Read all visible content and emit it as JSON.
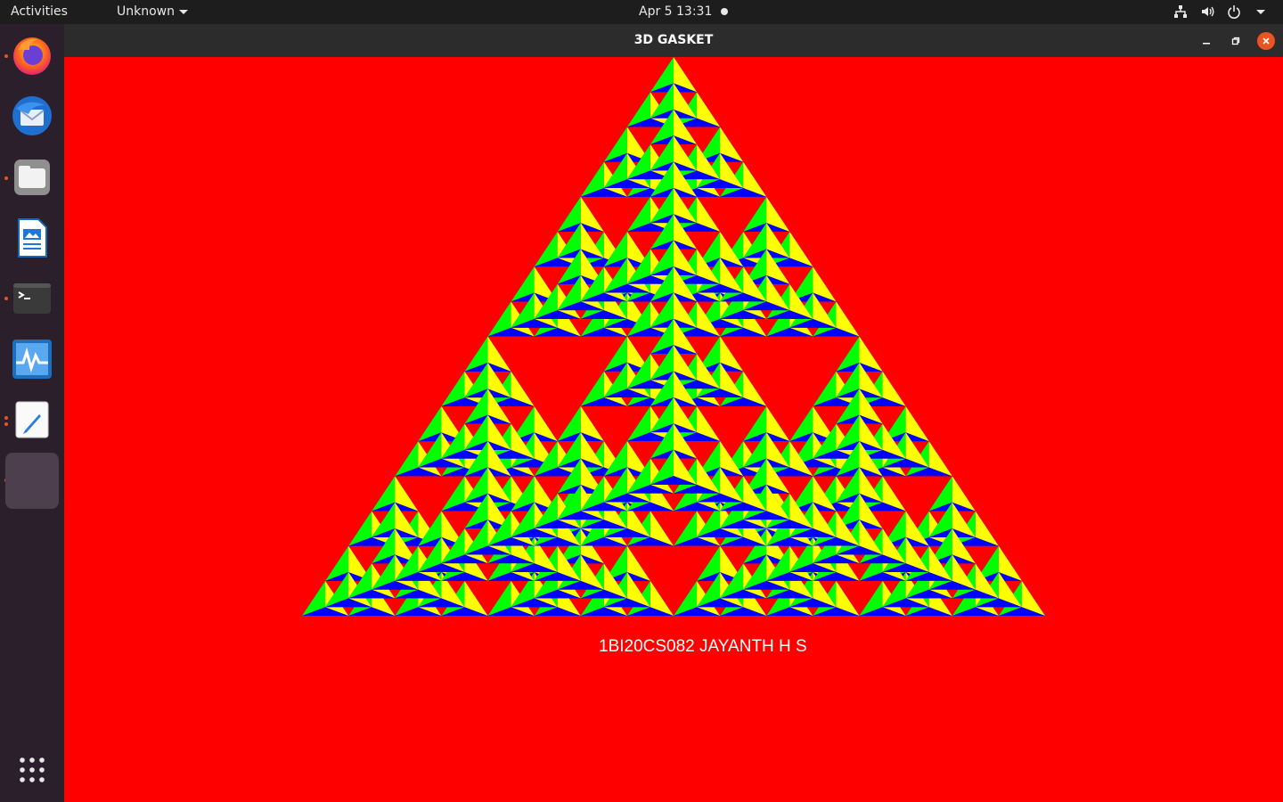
{
  "topbar": {
    "activities": "Activities",
    "app_menu": "Unknown",
    "clock": "Apr 5  13:31",
    "tray_icons": [
      "network-icon",
      "volume-icon",
      "power-icon"
    ]
  },
  "dock": {
    "items": [
      {
        "name": "firefox",
        "running": true
      },
      {
        "name": "thunderbird",
        "running": false
      },
      {
        "name": "files",
        "running": true
      },
      {
        "name": "libreoffice-writer",
        "running": false
      },
      {
        "name": "terminal",
        "running": true
      },
      {
        "name": "system-monitor",
        "running": false
      },
      {
        "name": "text-editor",
        "running": true
      },
      {
        "name": "gasket-app",
        "running": true,
        "active": true
      }
    ],
    "show_apps_icon": "grid-icon"
  },
  "window": {
    "title": "3D GASKET",
    "caption": "1BI20CS082 JAYANTH H S",
    "colors": {
      "background": "#ff0000",
      "face_green": "#00ff00",
      "face_yellow": "#ffff00",
      "face_blue": "#0000ff"
    },
    "subdivision_levels": 4
  }
}
